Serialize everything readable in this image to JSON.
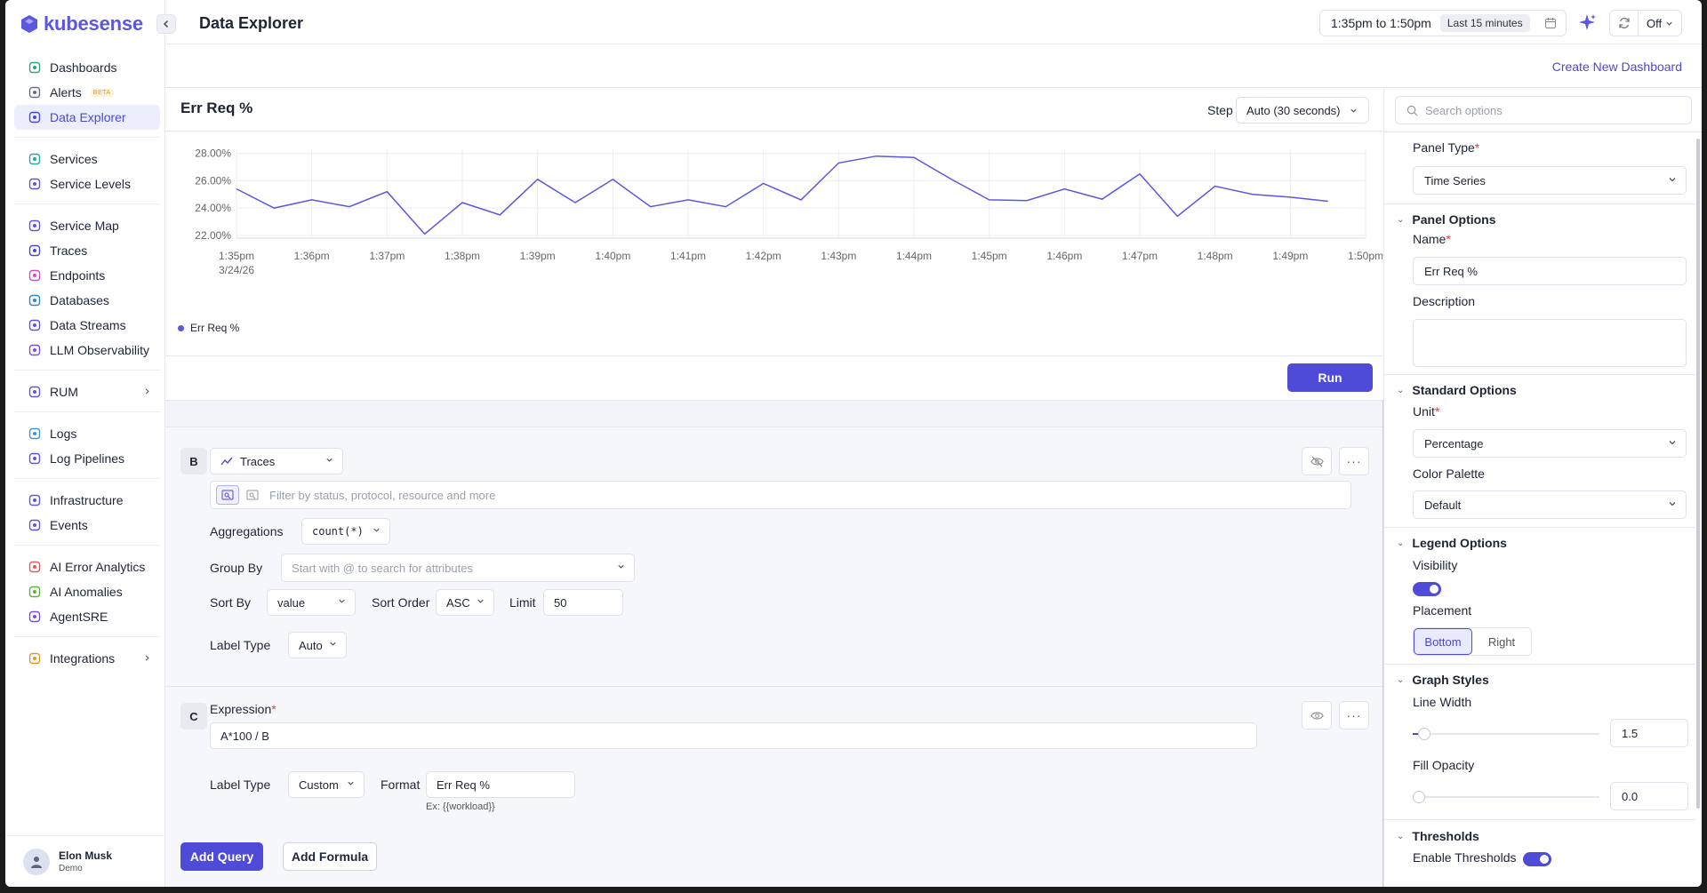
{
  "app": {
    "name": "kubesense",
    "page_title": "Data Explorer"
  },
  "sidebar": {
    "groups": [
      [
        {
          "label": "Dashboards",
          "icon": "dashboard-icon"
        },
        {
          "label": "Alerts",
          "icon": "alert-icon",
          "badge": "BETA"
        },
        {
          "label": "Data Explorer",
          "icon": "data-explorer-icon",
          "active": true
        }
      ],
      [
        {
          "label": "Services",
          "icon": "services-icon"
        },
        {
          "label": "Service Levels",
          "icon": "service-levels-icon"
        }
      ],
      [
        {
          "label": "Service Map",
          "icon": "service-map-icon"
        },
        {
          "label": "Traces",
          "icon": "traces-icon"
        },
        {
          "label": "Endpoints",
          "icon": "endpoints-icon"
        },
        {
          "label": "Databases",
          "icon": "database-icon"
        },
        {
          "label": "Data Streams",
          "icon": "data-streams-icon"
        },
        {
          "label": "LLM Observability",
          "icon": "sparkle-icon"
        }
      ],
      [
        {
          "label": "RUM",
          "icon": "rum-icon",
          "chevron": true
        }
      ],
      [
        {
          "label": "Logs",
          "icon": "logs-icon"
        },
        {
          "label": "Log Pipelines",
          "icon": "log-pipelines-icon"
        }
      ],
      [
        {
          "label": "Infrastructure",
          "icon": "infrastructure-icon"
        },
        {
          "label": "Events",
          "icon": "events-icon"
        }
      ],
      [
        {
          "label": "AI Error Analytics",
          "icon": "error-icon"
        },
        {
          "label": "AI Anomalies",
          "icon": "anomaly-icon"
        },
        {
          "label": "AgentSRE",
          "icon": "agent-icon"
        }
      ],
      [
        {
          "label": "Integrations",
          "icon": "integrations-icon",
          "chevron": true
        }
      ]
    ],
    "user": {
      "name": "Elon Musk",
      "org": "Demo"
    }
  },
  "header": {
    "time_range": "1:35pm to 1:50pm",
    "time_badge": "Last 15 minutes",
    "refresh": "Off"
  },
  "subheader": {
    "create_link": "Create New Dashboard"
  },
  "panel": {
    "title": "Err Req %",
    "step_label": "Step",
    "step_value": "Auto (30 seconds)",
    "run_label": "Run"
  },
  "chart_data": {
    "type": "line",
    "x": [
      "1:35pm",
      "1:35:30",
      "1:36pm",
      "1:36:30",
      "1:37pm",
      "1:37:30",
      "1:38pm",
      "1:38:30",
      "1:39pm",
      "1:39:30",
      "1:40pm",
      "1:40:30",
      "1:41pm",
      "1:41:30",
      "1:42pm",
      "1:42:30",
      "1:43pm",
      "1:43:30",
      "1:44pm",
      "1:44:30",
      "1:45pm",
      "1:45:30",
      "1:46pm",
      "1:46:30",
      "1:47pm",
      "1:47:30",
      "1:48pm",
      "1:48:30",
      "1:49pm",
      "1:49:30"
    ],
    "series": [
      {
        "name": "Err Req %",
        "color": "#5b57e0",
        "values": [
          25.4,
          24.0,
          24.6,
          24.1,
          25.2,
          22.1,
          24.4,
          23.5,
          26.1,
          24.4,
          26.1,
          24.1,
          24.6,
          24.1,
          25.8,
          24.6,
          27.3,
          27.8,
          27.7,
          26.1,
          24.6,
          24.55,
          25.4,
          24.65,
          26.5,
          23.4,
          25.6,
          25.0,
          24.8,
          24.5
        ]
      }
    ],
    "x_ticks": [
      "1:35pm",
      "1:36pm",
      "1:37pm",
      "1:38pm",
      "1:39pm",
      "1:40pm",
      "1:41pm",
      "1:42pm",
      "1:43pm",
      "1:44pm",
      "1:45pm",
      "1:46pm",
      "1:47pm",
      "1:48pm",
      "1:49pm",
      "1:50pm"
    ],
    "x_subtick": "3/24/26",
    "y_ticks": [
      "22.00%",
      "24.00%",
      "26.00%",
      "28.00%"
    ],
    "ylim": [
      21.8,
      28.3
    ],
    "grid": true,
    "legend": "bottom-left"
  },
  "query_b": {
    "label": "B",
    "source": "Traces",
    "filter_placeholder": "Filter by status, protocol, resource and more",
    "aggregations_label": "Aggregations",
    "aggregation_value": "count(*)",
    "group_by_label": "Group By",
    "group_by_placeholder": "Start with @ to search for attributes",
    "sort_by_label": "Sort By",
    "sort_by_value": "value",
    "sort_order_label": "Sort Order",
    "sort_order_value": "ASC",
    "limit_label": "Limit",
    "limit_value": "50",
    "label_type_label": "Label Type",
    "label_type_value": "Auto"
  },
  "formula_c": {
    "label": "C",
    "expression_label": "Expression",
    "expression_value": "A*100 / B",
    "label_type_label": "Label Type",
    "label_type_value": "Custom",
    "format_label": "Format",
    "format_value": "Err Req %",
    "format_hint": "Ex: {{workload}}"
  },
  "footer_buttons": {
    "add_query": "Add Query",
    "add_formula": "Add Formula"
  },
  "options": {
    "search_placeholder": "Search options",
    "panel_type_label": "Panel Type",
    "panel_type_value": "Time Series",
    "panel_options_title": "Panel Options",
    "name_label": "Name",
    "name_value": "Err Req %",
    "description_label": "Description",
    "standard_options_title": "Standard Options",
    "unit_label": "Unit",
    "unit_value": "Percentage",
    "color_palette_label": "Color Palette",
    "color_palette_value": "Default",
    "legend_options_title": "Legend Options",
    "visibility_label": "Visibility",
    "placement_label": "Placement",
    "placement_options": [
      "Bottom",
      "Right"
    ],
    "graph_styles_title": "Graph Styles",
    "line_width_label": "Line Width",
    "line_width_value": "1.5",
    "fill_opacity_label": "Fill Opacity",
    "fill_opacity_value": "0.0",
    "thresholds_title": "Thresholds",
    "enable_thresholds_label": "Enable Thresholds"
  }
}
